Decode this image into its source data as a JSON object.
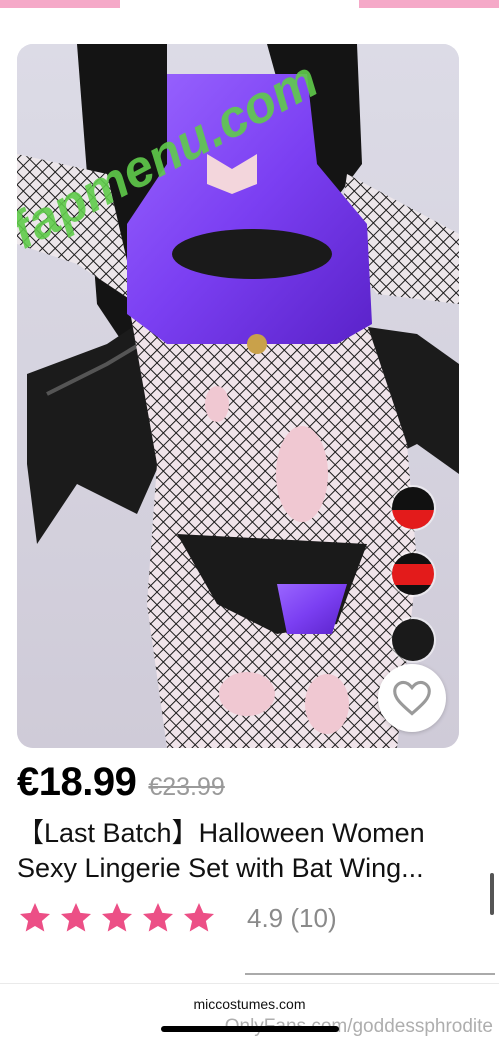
{
  "product": {
    "price": "€18.99",
    "old_price": "€23.99",
    "title_line1": "【Last Batch】Halloween Women",
    "title_line2": "Sexy Lingerie Set with Bat Wing...",
    "rating_value": "4.9 (10)",
    "stars": 5,
    "photo_description": "Product photo of purple latex top with fishnet bodysuit and bat wings"
  },
  "watermark": {
    "text": "fapmenu.com",
    "color": "#5fcb4a"
  },
  "color_options": [
    {
      "name": "black-red",
      "top": "#111111",
      "bottom": "#e31b1b"
    },
    {
      "name": "red-black",
      "top": "#e31b1b",
      "bottom": "#111111"
    },
    {
      "name": "black",
      "top": "#1a1a1a",
      "bottom": "#1a1a1a"
    }
  ],
  "footer": {
    "domain": "miccostumes.com",
    "onlyfans": "OnlyFans.com/goddessphrodite"
  },
  "colors": {
    "star": "#ec4f86",
    "accent_pink": "#f5a9c8",
    "purple": "#7b3ff2"
  }
}
